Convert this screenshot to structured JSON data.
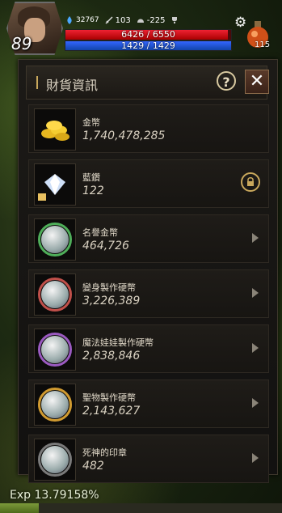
{
  "hud": {
    "level": "89",
    "stat1": "32767",
    "stat2": "103",
    "stat3": "-225",
    "hp_text": "6426 / 6550",
    "hp_fraction": 0.981,
    "mp_text": "1429 / 1429",
    "mp_fraction": 1.0,
    "potion_count": "115"
  },
  "panel": {
    "title": "財貨資訊",
    "help_label": "?",
    "close_label": "✕"
  },
  "items": [
    {
      "name": "金幣",
      "amount": "1,740,478,285",
      "icon": "gold-coins-icon",
      "action": "none",
      "ring": "#d8b040"
    },
    {
      "name": "藍鑽",
      "amount": "122",
      "icon": "blue-diamond-icon",
      "action": "lock",
      "ring": "#7aa0d0"
    },
    {
      "name": "名譽金幣",
      "amount": "464,726",
      "icon": "honor-coin-icon",
      "action": "arrow",
      "ring": "#4fae5a"
    },
    {
      "name": "變身製作硬幣",
      "amount": "3,226,389",
      "icon": "transform-coin-icon",
      "action": "arrow",
      "ring": "#c0504a"
    },
    {
      "name": "魔法娃娃製作硬幣",
      "amount": "2,838,846",
      "icon": "magic-doll-coin-icon",
      "action": "arrow",
      "ring": "#9a5ac0"
    },
    {
      "name": "聖物製作硬幣",
      "amount": "2,143,627",
      "icon": "relic-coin-icon",
      "action": "arrow",
      "ring": "#d09a30"
    },
    {
      "name": "死神的印章",
      "amount": "482",
      "icon": "reaper-seal-icon",
      "action": "arrow",
      "ring": "#7a7a7a"
    }
  ],
  "exp": {
    "text": "Exp 13.79158%",
    "fraction": 0.1379
  }
}
